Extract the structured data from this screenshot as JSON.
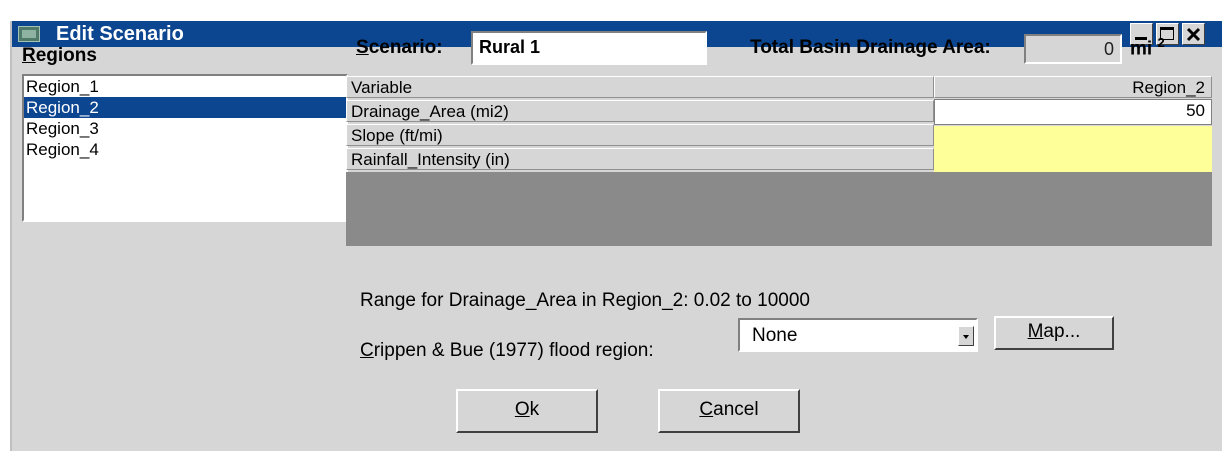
{
  "window": {
    "title": "Edit Scenario"
  },
  "regions": {
    "label": "Regions",
    "items": [
      {
        "label": "Region_1",
        "selected": false
      },
      {
        "label": "Region_2",
        "selected": true
      },
      {
        "label": "Region_3",
        "selected": false
      },
      {
        "label": "Region_4",
        "selected": false
      }
    ]
  },
  "scenario": {
    "label": "Scenario:",
    "value": "Rural 1"
  },
  "basin": {
    "label": "Total Basin Drainage Area:",
    "value": "0",
    "unit": "mi",
    "unit_sup": "2"
  },
  "grid": {
    "header_variable": "Variable",
    "header_region": "Region_2",
    "rows": [
      {
        "variable": "Drainage_Area (mi2)",
        "value": "50",
        "highlight": false
      },
      {
        "variable": "Slope (ft/mi)",
        "value": "",
        "highlight": true
      },
      {
        "variable": "Rainfall_Intensity (in)",
        "value": "",
        "highlight": true
      }
    ],
    "highlight_color": "#ffff99"
  },
  "range_text": "Range for Drainage_Area in Region_2:  0.02 to 10000",
  "flood_region": {
    "label": "Crippen & Bue (1977) flood region:",
    "value": "None"
  },
  "buttons": {
    "map": "Map...",
    "ok": "Ok",
    "cancel": "Cancel"
  },
  "colors": {
    "title_bar": "#0c4690",
    "selection": "#0c4690",
    "dialog_bg": "#d6d6d6"
  }
}
